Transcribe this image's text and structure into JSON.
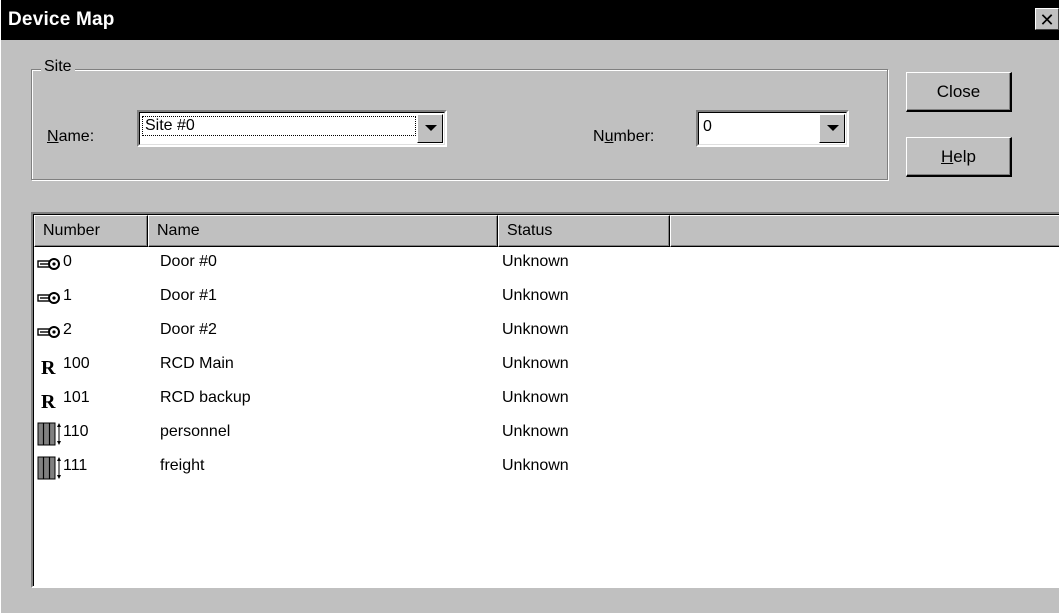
{
  "window": {
    "title": "Device Map",
    "close_glyph": "✕"
  },
  "site": {
    "group_label": "Site",
    "name_label_prefix": "",
    "name_label_accel": "N",
    "name_label_rest": "ame:",
    "name_value": "Site #0",
    "number_label_pre": "N",
    "number_label_accel": "u",
    "number_label_rest": "mber:",
    "number_value": "0"
  },
  "buttons": {
    "close_label": "Close",
    "help_accel": "H",
    "help_rest": "elp"
  },
  "table": {
    "columns": [
      "Number",
      "Name",
      "Status",
      ""
    ],
    "rows": [
      {
        "icon": "door-key-icon",
        "number": "0",
        "name": "Door #0",
        "status": "Unknown"
      },
      {
        "icon": "door-key-icon",
        "number": "1",
        "name": "Door #1",
        "status": "Unknown"
      },
      {
        "icon": "door-key-icon",
        "number": "2",
        "name": "Door #2",
        "status": "Unknown"
      },
      {
        "icon": "rcd-icon",
        "number": "100",
        "name": "RCD Main",
        "status": "Unknown"
      },
      {
        "icon": "rcd-icon",
        "number": "101",
        "name": "RCD backup",
        "status": "Unknown"
      },
      {
        "icon": "elevator-icon",
        "number": "110",
        "name": "personnel",
        "status": "Unknown"
      },
      {
        "icon": "elevator-icon",
        "number": "111",
        "name": "freight",
        "status": "Unknown"
      }
    ]
  },
  "colors": {
    "face": "#c0c0c0",
    "title_bg": "#000000",
    "title_fg": "#ffffff"
  }
}
